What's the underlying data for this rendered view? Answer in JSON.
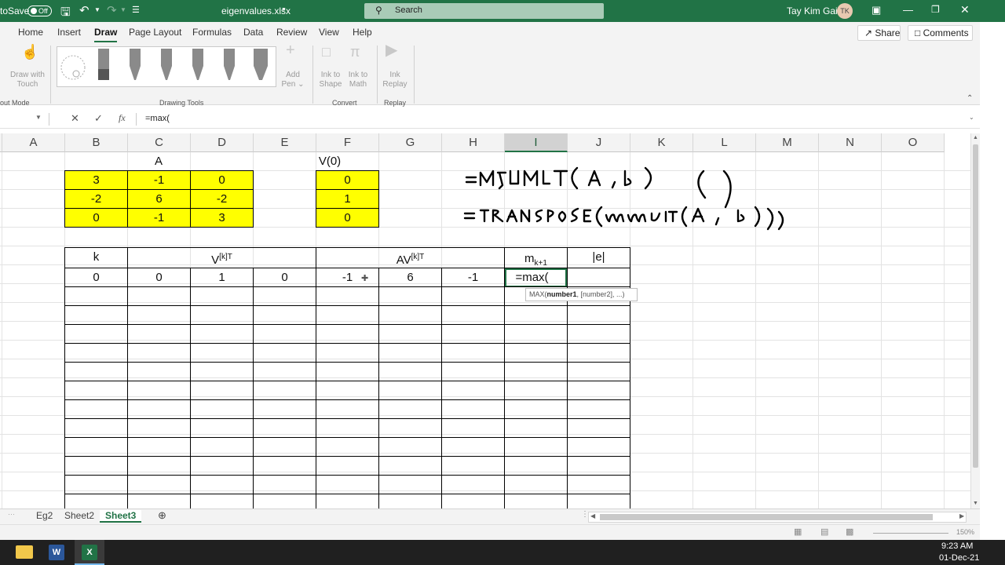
{
  "titlebar": {
    "autosave": "toSave",
    "autosave_state": "Off",
    "file_name": "eigenvalues.xlsx",
    "search_placeholder": "Search",
    "user_name": "Tay Kim Gaik",
    "user_initials": "TK"
  },
  "menu": {
    "tabs": [
      "Home",
      "Insert",
      "Draw",
      "Page Layout",
      "Formulas",
      "Data",
      "Review",
      "View",
      "Help"
    ],
    "active": "Draw",
    "share": "Share",
    "comments": "Comments"
  },
  "ribbon": {
    "draw_with_touch_1": "Draw with",
    "draw_with_touch_2": "Touch",
    "add_pen_1": "Add",
    "add_pen_2": "Pen",
    "ink_shape_1": "Ink to",
    "ink_shape_2": "Shape",
    "ink_math_1": "Ink to",
    "ink_math_2": "Math",
    "ink_replay_1": "Ink",
    "ink_replay_2": "Replay",
    "groups": {
      "input": "out Mode",
      "drawing_tools": "Drawing Tools",
      "convert": "Convert",
      "replay": "Replay"
    }
  },
  "formula_bar": {
    "content": "=max("
  },
  "columns": [
    "A",
    "B",
    "C",
    "D",
    "E",
    "F",
    "G",
    "H",
    "I",
    "J",
    "K",
    "L",
    "M",
    "N",
    "O"
  ],
  "selected_column": "I",
  "grid": {
    "header_A": "A",
    "header_v0": "V(0)",
    "matrix": [
      [
        "3",
        "-1",
        "0"
      ],
      [
        "-2",
        "6",
        "-2"
      ],
      [
        "0",
        "-1",
        "3"
      ]
    ],
    "vector": [
      "0",
      "1",
      "0"
    ],
    "table_headers": {
      "k": "k",
      "v": "V",
      "v_sup": "[k]T",
      "av": "AV",
      "av_sup": "[k]T",
      "m": "m",
      "m_sub": "k+1",
      "e": "|e|"
    },
    "row1": [
      "0",
      "0",
      "1",
      "0",
      "-1",
      "6",
      "-1"
    ],
    "editing_cell": "=max("
  },
  "tooltip": {
    "fn": "MAX(",
    "arg1": "number1",
    ", rest": ", [number2], ...)"
  },
  "ink_notes": [
    "=MMULT(A,b)",
    "=TRANSPOSE(MMULT(A,b))"
  ],
  "sheets": [
    "Eg2",
    "Sheet2",
    "Sheet3"
  ],
  "active_sheet": "Sheet3",
  "status": {
    "zoom": "150%"
  },
  "taskbar": {
    "time": "9:23 AM",
    "date": "01-Dec-21"
  }
}
